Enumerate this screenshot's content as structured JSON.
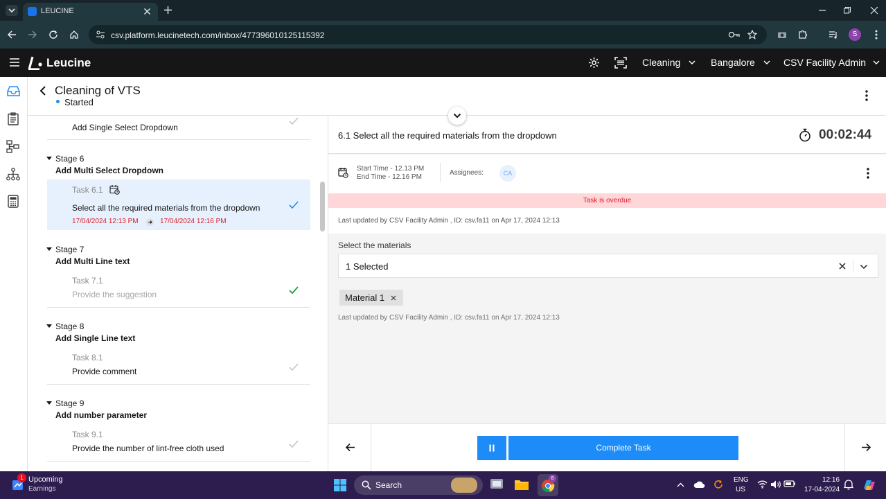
{
  "browser": {
    "tab_title": "LEUCINE",
    "url": "csv.platform.leucinetech.com/inbox/477396010125115392",
    "profile_initial": "S"
  },
  "app": {
    "brand": "Leucine",
    "module": "Cleaning",
    "facility": "Bangalore",
    "role": "CSV Facility Admin"
  },
  "job": {
    "title": "Cleaning of VTS",
    "status": "Started"
  },
  "task_list": {
    "prev_task_title": "Add Single Select Dropdown",
    "stages": [
      {
        "stage": "Stage 6",
        "name": "Add Multi Select Dropdown",
        "task": "Task 6.1",
        "title": "Select all the required materials from the dropdown",
        "start": "17/04/2024 12:13 PM",
        "end": "17/04/2024 12:16 PM"
      },
      {
        "stage": "Stage 7",
        "name": "Add Multi Line text",
        "task": "Task 7.1",
        "title": "Provide the suggestion"
      },
      {
        "stage": "Stage 8",
        "name": "Add Single Line text",
        "task": "Task 8.1",
        "title": "Provide comment"
      },
      {
        "stage": "Stage 9",
        "name": "Add number parameter",
        "task": "Task 9.1",
        "title": "Provide the number of lint-free cloth used"
      }
    ]
  },
  "task": {
    "heading": "6.1 Select all the required materials from the dropdown",
    "timer": "00:02:44",
    "start_time": "Start Time - 12.13 PM",
    "end_time": "End Time - 12.16 PM",
    "assignees_label": "Assignees:",
    "assignee_initials": "CA",
    "overdue": "Task is overdue",
    "last_updated_1": "Last updated by CSV Facility Admin , ID: csv.fa11 on Apr 17, 2024 12:13",
    "field_label": "Select the materials",
    "field_value": "1 Selected",
    "chip": "Material 1",
    "last_updated_2": "Last updated by CSV Facility Admin , ID: csv.fa11 on Apr 17, 2024 12:13",
    "complete_label": "Complete Task"
  },
  "taskbar": {
    "widget_title": "Upcoming",
    "widget_sub": "Earnings",
    "widget_badge": "1",
    "search": "Search",
    "lang1": "ENG",
    "lang2": "US",
    "time": "12:16",
    "date": "17-04-2024",
    "chrome_badge": "8"
  },
  "colors": {
    "accent": "#1d8cf8",
    "overdue_bg": "#ffd7d9",
    "overdue_text": "#da1e28",
    "selected_row": "#e7f1fd",
    "check_green": "#24a148",
    "date_red": "#da1e28"
  }
}
